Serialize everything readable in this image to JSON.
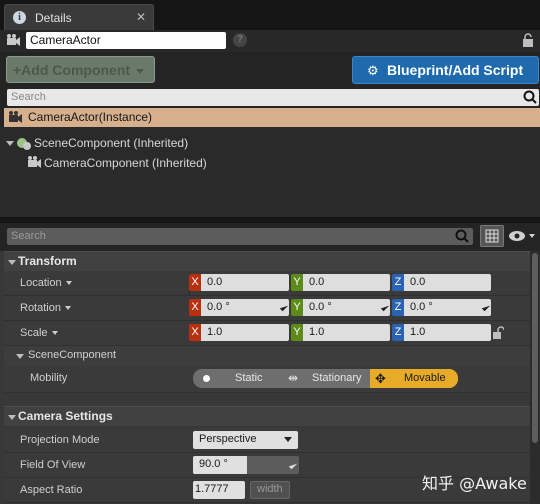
{
  "tab": {
    "title": "Details",
    "close": "✕"
  },
  "actor": {
    "name": "CameraActor",
    "help": "?"
  },
  "buttons": {
    "add_component": "+Add Component",
    "blueprint": "Blueprint/Add Script"
  },
  "search1": {
    "placeholder": "Search"
  },
  "tree": {
    "instance": "CameraActor(Instance)",
    "items": [
      "SceneComponent (Inherited)",
      "CameraComponent (Inherited)"
    ]
  },
  "search2": {
    "placeholder": "Search"
  },
  "transform": {
    "title": "Transform",
    "location": {
      "label": "Location",
      "x": "0.0",
      "y": "0.0",
      "z": "0.0"
    },
    "rotation": {
      "label": "Rotation",
      "x": "0.0 °",
      "y": "0.0 °",
      "z": "0.0 °"
    },
    "scale": {
      "label": "Scale",
      "x": "1.0",
      "y": "1.0",
      "z": "1.0"
    },
    "axes": {
      "x": "X",
      "y": "Y",
      "z": "Z"
    }
  },
  "scene_component": {
    "title": "SceneComponent",
    "mobility_label": "Mobility",
    "mobility": {
      "static": "Static",
      "stationary": "Stationary",
      "movable": "Movable",
      "selected": "Movable"
    }
  },
  "camera": {
    "title": "Camera Settings",
    "projection_mode": {
      "label": "Projection Mode",
      "value": "Perspective"
    },
    "fov": {
      "label": "Field Of View",
      "value": "90.0 °"
    },
    "aspect": {
      "label": "Aspect Ratio",
      "value": "1.7777",
      "constraint": "width"
    }
  },
  "watermark": "知乎 @Awake",
  "colors": {
    "blueprint": "#1e6aad",
    "movable": "#e8ab28",
    "instance": "#d6b08c",
    "x_axis": "#b8310f",
    "y_axis": "#5c8b1a",
    "z_axis": "#2b63b3"
  }
}
